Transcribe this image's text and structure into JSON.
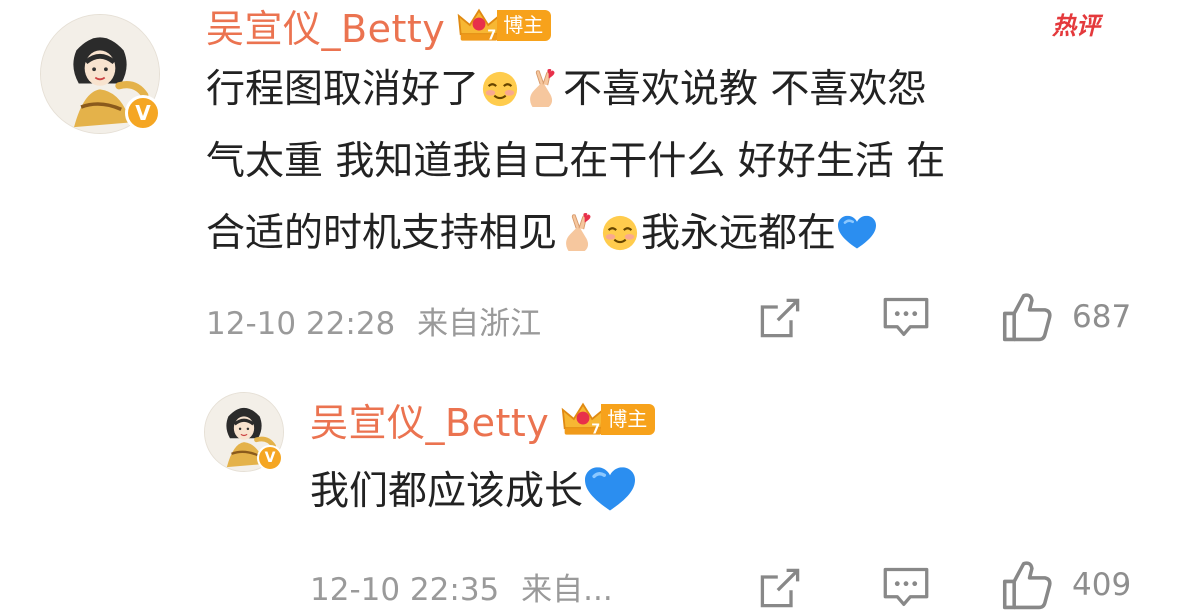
{
  "colors": {
    "username": "#eb7350",
    "badge_orange": "#f7a21b",
    "hot_red": "#e4393c",
    "meta_gray": "#9a9a9a",
    "text_dark": "#222222",
    "heart_blue": "#2b8ef0"
  },
  "hot_label": "热评",
  "comments": [
    {
      "username": "吴宣仪_Betty",
      "role_badge": "博主",
      "verified_icon": "v-verified-icon",
      "content_lines": [
        [
          "行程图取消好了",
          "{smile}",
          "{hand-heart}",
          "不喜欢说教 不喜欢怨"
        ],
        [
          "气太重 我知道我自己在干什么 好好生活 在"
        ],
        [
          "合适的时机支持相见",
          "{hand-heart}",
          "{smile}",
          "我永远都在",
          "{blue-heart}"
        ]
      ],
      "text": {
        "l1a": "行程图取消好了",
        "l1b": "不喜欢说教 不喜欢怨",
        "l2": "气太重 我知道我自己在干什么 好好生活 在",
        "l3a": "合适的时机支持相见",
        "l3b": "我永远都在"
      },
      "time": "12-10 22:28",
      "location": "来自浙江",
      "likes": "687"
    },
    {
      "username": "吴宣仪_Betty",
      "role_badge": "博主",
      "verified_icon": "v-verified-icon",
      "text": {
        "l1": "我们都应该成长"
      },
      "time": "12-10 22:35",
      "location": "来自...",
      "likes": "409"
    }
  ],
  "actions": [
    "share-icon",
    "comment-icon",
    "like-icon"
  ]
}
